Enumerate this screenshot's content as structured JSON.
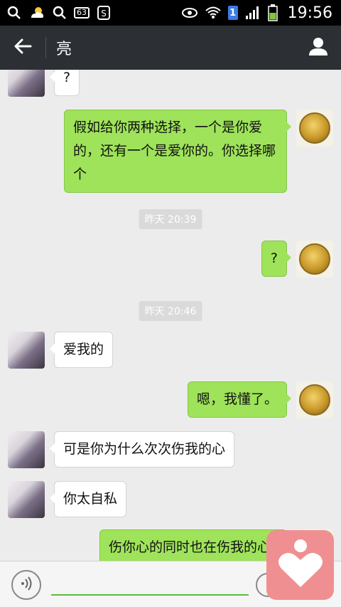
{
  "status_bar": {
    "badge_count": "63",
    "notif_one": "1",
    "time": "19:56"
  },
  "header": {
    "title": "亮"
  },
  "messages": [
    {
      "side": "left",
      "text": "?"
    },
    {
      "side": "right",
      "text": "假如给你两种选择，一个是你爱的，还有一个是爱你的。你选择哪个"
    },
    {
      "timestamp": "昨天 20:39"
    },
    {
      "side": "right",
      "text": "?"
    },
    {
      "timestamp": "昨天 20:46"
    },
    {
      "side": "left",
      "text": "爱我的"
    },
    {
      "side": "right",
      "text": "嗯，我懂了。"
    },
    {
      "side": "left",
      "text": "可是你为什么次次伤我的心"
    },
    {
      "side": "left",
      "text": "你太自私"
    },
    {
      "side": "right",
      "text": "伤你心的同时也在伤我的心"
    }
  ],
  "colors": {
    "title_bg": "#2c2f33",
    "sent_bubble": "#9ee35a",
    "chat_bg": "#ececec",
    "overlay": "#f08f91"
  },
  "icons": {
    "back": "arrow-left-icon",
    "profile": "person-icon",
    "voice": "voice-icon",
    "emoji": "smile-icon",
    "overlay": "heart-icon"
  }
}
